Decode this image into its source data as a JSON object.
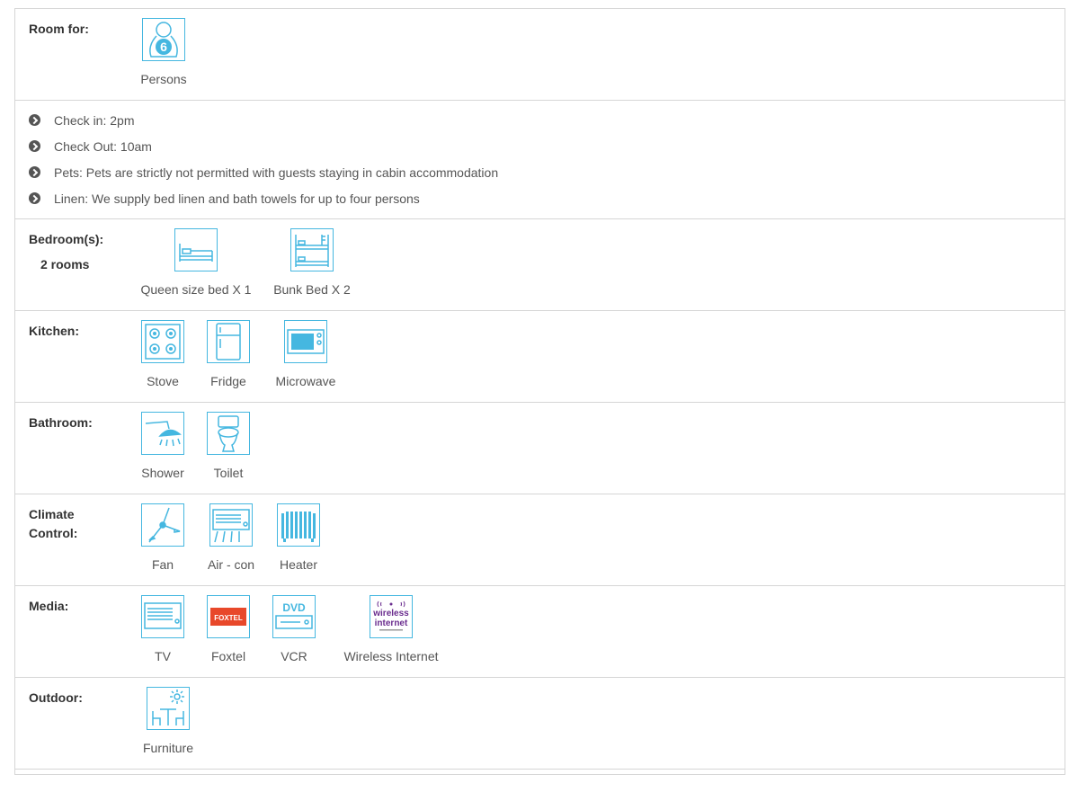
{
  "room_for": {
    "label": "Room for:",
    "persons_count": "6",
    "persons_label": "Persons"
  },
  "info": [
    "Check in: 2pm",
    "Check Out: 10am",
    "Pets: Pets are strictly not permitted with guests staying in cabin accommodation",
    "Linen: We supply bed linen and bath towels for up to four persons"
  ],
  "bedrooms": {
    "label": "Bedroom(s):",
    "rooms": "2 rooms",
    "items": [
      "Queen size bed X 1",
      "Bunk Bed X 2"
    ]
  },
  "kitchen": {
    "label": "Kitchen:",
    "items": [
      "Stove",
      "Fridge",
      "Microwave"
    ]
  },
  "bathroom": {
    "label": "Bathroom:",
    "items": [
      "Shower",
      "Toilet"
    ]
  },
  "climate": {
    "label_line1": "Climate",
    "label_line2": "Control:",
    "items": [
      "Fan",
      "Air - con",
      "Heater"
    ]
  },
  "media": {
    "label": "Media:",
    "items": [
      "TV",
      "Foxtel",
      "VCR",
      "Wireless Internet"
    ],
    "foxtel_logo": "FOXTEL",
    "dvd_logo": "DVD",
    "wireless_logo_line1": "wireless",
    "wireless_logo_line2": "internet"
  },
  "outdoor": {
    "label": "Outdoor:",
    "items": [
      "Furniture"
    ]
  },
  "colors": {
    "accent": "#45b7e0",
    "text": "#555555",
    "label": "#333333",
    "border": "#d6d6d6",
    "foxtel": "#e8482a",
    "wireless": "#6a2c8e"
  }
}
